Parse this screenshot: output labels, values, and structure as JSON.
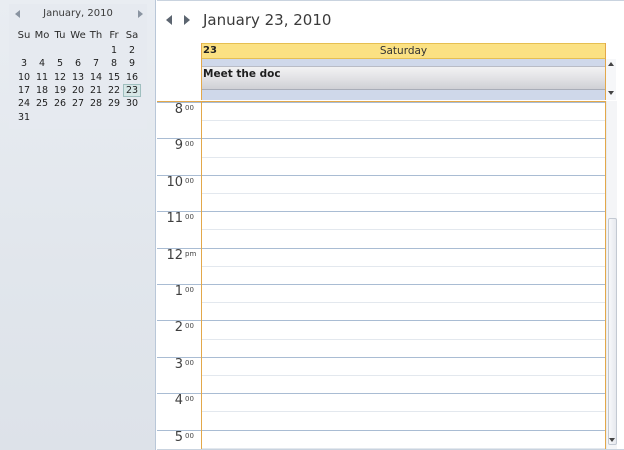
{
  "mini_calendar": {
    "month_label": "January, 2010",
    "weekday_headers": [
      "Su",
      "Mo",
      "Tu",
      "We",
      "Th",
      "Fr",
      "Sa"
    ],
    "weeks": [
      [
        "",
        "",
        "",
        "",
        "",
        "1",
        "2"
      ],
      [
        "3",
        "4",
        "5",
        "6",
        "7",
        "8",
        "9"
      ],
      [
        "10",
        "11",
        "12",
        "13",
        "14",
        "15",
        "16"
      ],
      [
        "17",
        "18",
        "19",
        "20",
        "21",
        "22",
        "23"
      ],
      [
        "24",
        "25",
        "26",
        "27",
        "28",
        "29",
        "30"
      ],
      [
        "31",
        "",
        "",
        "",
        "",
        "",
        ""
      ]
    ],
    "selected_day": "23"
  },
  "header": {
    "title": "January 23, 2010"
  },
  "day_header": {
    "day_number": "23",
    "day_name": "Saturday"
  },
  "all_day_event": {
    "title": "Meet the doc"
  },
  "time_slots": [
    {
      "hour": "8",
      "suffix": "00"
    },
    {
      "hour": "9",
      "suffix": "00"
    },
    {
      "hour": "10",
      "suffix": "00"
    },
    {
      "hour": "11",
      "suffix": "00"
    },
    {
      "hour": "12",
      "suffix": "pm"
    },
    {
      "hour": "1",
      "suffix": "00"
    },
    {
      "hour": "2",
      "suffix": "00"
    },
    {
      "hour": "3",
      "suffix": "00"
    },
    {
      "hour": "4",
      "suffix": "00"
    },
    {
      "hour": "5",
      "suffix": "00"
    }
  ],
  "colors": {
    "day_header_bg": "#fbe183",
    "today_border": "#e3a84a",
    "grid_line": "#a9bcd3",
    "selected_day_bg": "#d6e6e6"
  }
}
